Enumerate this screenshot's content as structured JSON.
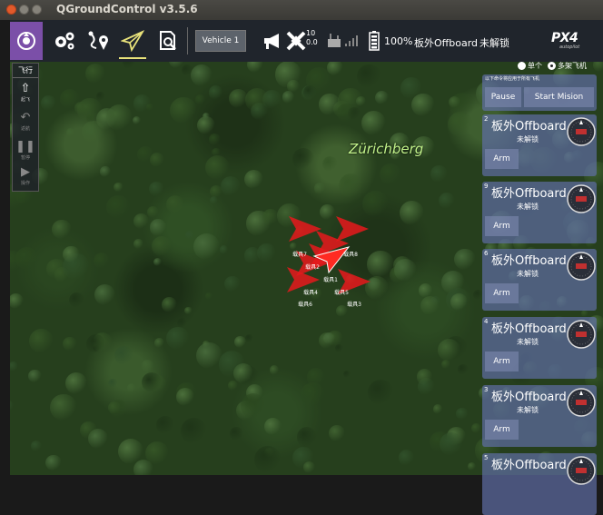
{
  "window": {
    "title": "QGroundControl v3.5.6"
  },
  "toolbar": {
    "vehicle_selector": "Vehicle 1",
    "satellite_count": "10",
    "hdop": "0.0",
    "battery": "100%",
    "flight_mode": "板外Offboard",
    "arm_state": "未解锁",
    "brand": "PX4",
    "brand_sub": "autopilot"
  },
  "fly_panel": {
    "title": "飞行",
    "buttons": [
      {
        "icon": "takeoff-icon",
        "label": "起飞"
      },
      {
        "icon": "return-icon",
        "label": "返航"
      },
      {
        "icon": "pause-icon",
        "label": "暂停"
      },
      {
        "icon": "action-icon",
        "label": "操作"
      }
    ]
  },
  "map": {
    "place_label": "Zürichberg"
  },
  "mode_select": {
    "single": "单个",
    "multi": "多架飞机"
  },
  "multi_command": {
    "hint": "以下命令将应用于所有飞机",
    "pause": "Pause",
    "start_mission": "Start Mision"
  },
  "vehicles": [
    {
      "id": "2",
      "mode": "板外Offboard",
      "state": "未解锁",
      "arm": "Arm"
    },
    {
      "id": "9",
      "mode": "板外Offboard",
      "state": "未解锁",
      "arm": "Arm"
    },
    {
      "id": "6",
      "mode": "板外Offboard",
      "state": "未解锁",
      "arm": "Arm"
    },
    {
      "id": "4",
      "mode": "板外Offboard",
      "state": "未解锁",
      "arm": "Arm"
    },
    {
      "id": "3",
      "mode": "板外Offboard",
      "state": "未解锁",
      "arm": "Arm"
    },
    {
      "id": "5",
      "mode": "板外Offboard",
      "state": "",
      "arm": ""
    }
  ],
  "drone_labels": [
    "载具7",
    "载具8",
    "载具2",
    "载具1",
    "载具4",
    "载具5",
    "载具6",
    "载具3"
  ],
  "colors": {
    "purple": "#7b4fa8",
    "card": "#5f6ea5",
    "drone": "#e8191c",
    "accent": "#e8e27a"
  }
}
